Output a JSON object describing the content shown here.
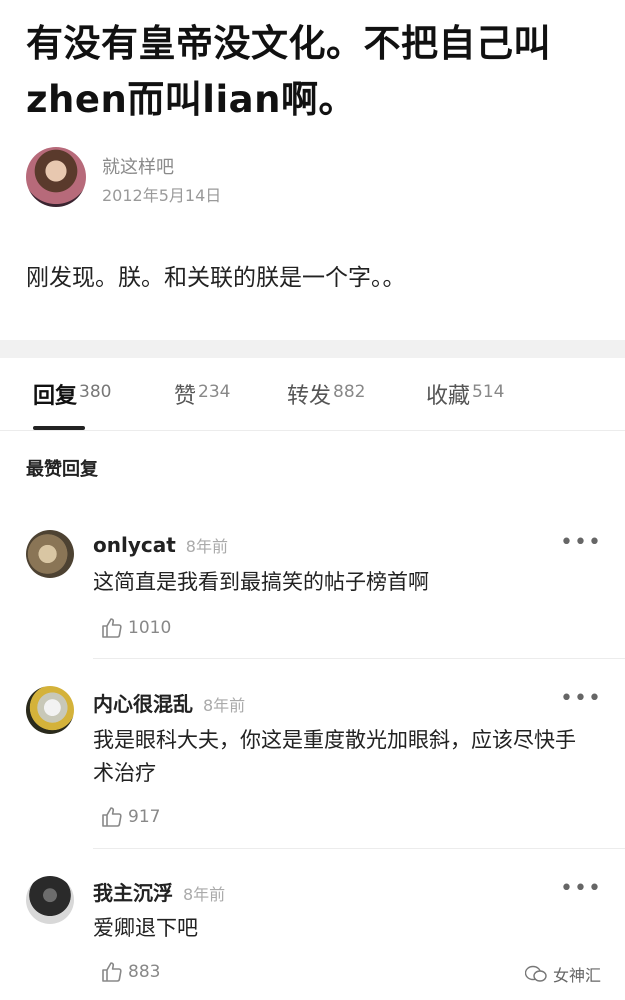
{
  "post": {
    "title": "有没有皇帝没文化。不把自己叫zhen而叫lian啊。",
    "author": "就这样吧",
    "date": "2012年5月14日",
    "body": "刚发现。朕。和关联的朕是一个字。。"
  },
  "tabs": [
    {
      "label": "回复",
      "count": "380"
    },
    {
      "label": "赞",
      "count": "234"
    },
    {
      "label": "转发",
      "count": "882"
    },
    {
      "label": "收藏",
      "count": "514"
    }
  ],
  "section_label": "最赞回复",
  "comments": [
    {
      "name": "onlycat",
      "time": "8年前",
      "text": "这简直是我看到最搞笑的帖子榜首啊",
      "likes": "1010"
    },
    {
      "name": "内心很混乱",
      "time": "8年前",
      "text": "我是眼科大夫，你这是重度散光加眼斜，应该尽快手术治疗",
      "likes": "917"
    },
    {
      "name": "我主沉浮",
      "time": "8年前",
      "text": "爱卿退下吧",
      "likes": "883"
    }
  ],
  "more_glyph": "•••",
  "watermark": "女神汇"
}
